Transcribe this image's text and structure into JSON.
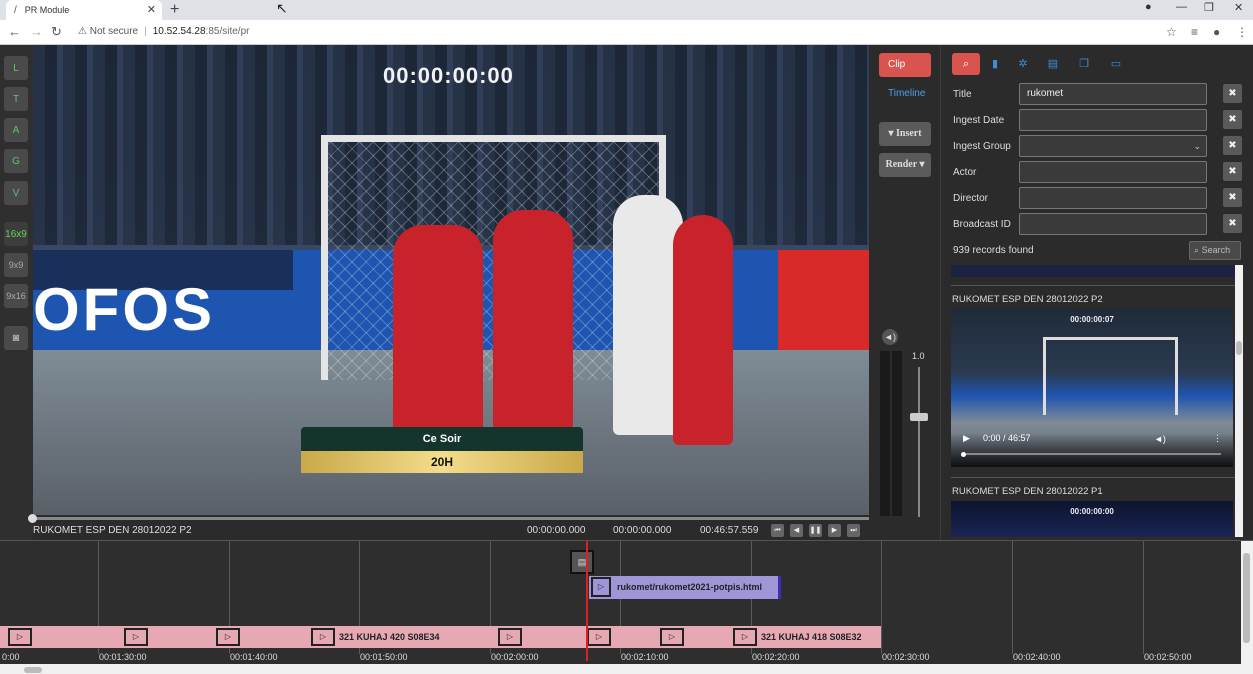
{
  "browser": {
    "tab_title": "PR Module",
    "tab_close": "✕",
    "new_tab": "+",
    "not_secure": "Not secure",
    "url_host": "10.52.54.28",
    "url_port": ":85",
    "url_path": "/site/pr"
  },
  "left_tools": [
    {
      "label": "L"
    },
    {
      "label": "T"
    },
    {
      "label": "A"
    },
    {
      "label": "G"
    },
    {
      "label": "V"
    },
    {
      "label": "16x9"
    },
    {
      "label": "9x9"
    },
    {
      "label": "9x16"
    }
  ],
  "video": {
    "timecode": "00:00:00:00",
    "overlay_top": "Ce Soir",
    "overlay_bottom": "20H",
    "clip_name": "RUKOMET ESP DEN 28012022 P2",
    "tc_in": "00:00:00.000",
    "tc_out": "00:00:00.000",
    "duration": "00:46:57.559",
    "ad_text": "OFOS"
  },
  "controls": {
    "clip": "Clip",
    "timeline": "Timeline",
    "insert": "Insert",
    "render": "Render",
    "volume": "1.0"
  },
  "search": {
    "fields": [
      {
        "label": "Title",
        "value": "rukomet"
      },
      {
        "label": "Ingest Date",
        "value": ""
      },
      {
        "label": "Ingest Group",
        "value": ""
      },
      {
        "label": "Actor",
        "value": ""
      },
      {
        "label": "Director",
        "value": ""
      },
      {
        "label": "Broadcast ID",
        "value": ""
      }
    ],
    "records": "939 records found",
    "search_button": "Search",
    "results": [
      {
        "title": "RUKOMET ESP DEN 28012022 P2",
        "timecode": "00:00:00:07",
        "player_time": "0:00 / 46:57"
      },
      {
        "title": "RUKOMET ESP DEN 28012022 P1",
        "timecode": "00:00:00:00"
      }
    ]
  },
  "timeline": {
    "overlay_clip": "rukomet/rukomet2021-potpis.html",
    "clip_a": "321 KUHAJ 420 S08E34",
    "clip_b": "321 KUHAJ 418 S08E32",
    "ticks": [
      "0:00",
      "00:01:30:00",
      "00:01:40:00",
      "00:01:50:00",
      "00:02:00:00",
      "00:02:10:00",
      "00:02:20:00",
      "00:02:30:00",
      "00:02:40:00",
      "00:02:50:00"
    ]
  }
}
